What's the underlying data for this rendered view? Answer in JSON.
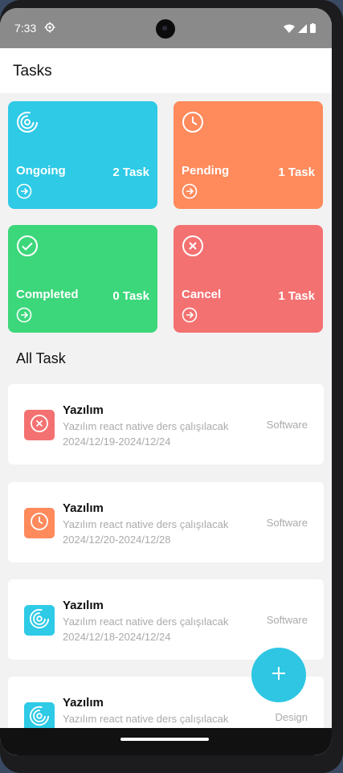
{
  "status": {
    "time": "7:33"
  },
  "header": {
    "title": "Tasks"
  },
  "summary": [
    {
      "label": "Ongoing",
      "count": "2 Task",
      "color": "#2ecae6",
      "icon": "progress-ring-icon"
    },
    {
      "label": "Pending",
      "count": "1 Task",
      "color": "#ff8a5c",
      "icon": "clock-icon"
    },
    {
      "label": "Completed",
      "count": "0 Task",
      "color": "#3cd77b",
      "icon": "check-circle-icon"
    },
    {
      "label": "Cancel",
      "count": "1 Task",
      "color": "#f47171",
      "icon": "x-circle-icon"
    }
  ],
  "all_tasks_title": "All Task",
  "tasks": [
    {
      "title": "Yazılım",
      "description": "Yazılım react native ders çalışılacak",
      "dates": "2024/12/19-2024/12/24",
      "category": "Software",
      "status_icon": "x-circle-icon",
      "color": "#f47171"
    },
    {
      "title": "Yazılım",
      "description": "Yazılım react native ders çalışılacak",
      "dates": "2024/12/20-2024/12/28",
      "category": "Software",
      "status_icon": "clock-icon",
      "color": "#ff8a5c"
    },
    {
      "title": "Yazılım",
      "description": "Yazılım react native ders çalışılacak",
      "dates": "2024/12/18-2024/12/24",
      "category": "Software",
      "status_icon": "progress-ring-icon",
      "color": "#2ecae6"
    },
    {
      "title": "Yazılım",
      "description": "Yazılım react native ders çalışılacak",
      "dates": "",
      "category": "Design",
      "status_icon": "progress-ring-icon",
      "color": "#2ecae6"
    }
  ],
  "fab": {
    "icon": "plus-icon",
    "color": "#2ec6e3"
  }
}
